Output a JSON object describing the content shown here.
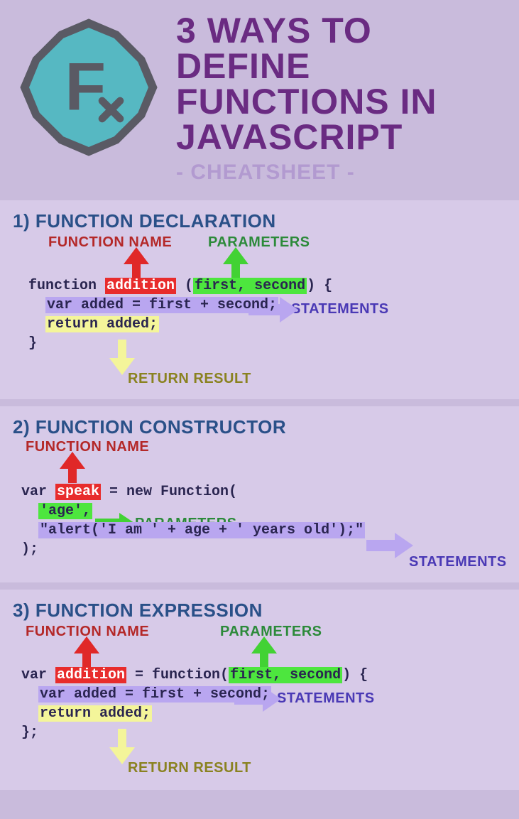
{
  "header": {
    "title": "3 WAYS TO DEFINE FUNCTIONS IN JAVASCRIPT",
    "subtitle": "- CHEATSHEET -"
  },
  "labels": {
    "function_name": "FUNCTION NAME",
    "parameters": "PARAMETERS",
    "statements": "STATEMENTS",
    "return_result": "RETURN RESULT"
  },
  "sections": [
    {
      "title": "1) FUNCTION DECLARATION",
      "code": {
        "keyword": "function ",
        "name": "addition",
        "after_name": " (",
        "params": "first, second",
        "after_params": ") {",
        "stmt": "var added = first + second;",
        "ret": "return added;",
        "close": "}"
      }
    },
    {
      "title": "2) FUNCTION CONSTRUCTOR",
      "code": {
        "keyword": "var ",
        "name": "speak",
        "after_name": " = new Function(",
        "params": "'age',",
        "stmt": "\"alert('I am ' + age + ' years old');\"",
        "close": ");"
      }
    },
    {
      "title": "3) FUNCTION EXPRESSION",
      "code": {
        "keyword": "var ",
        "name": "addition",
        "after_name": " = function(",
        "params": "first, second",
        "after_params": ") {",
        "stmt": "var added = first + second;",
        "ret": "return added;",
        "close": "};"
      }
    }
  ]
}
